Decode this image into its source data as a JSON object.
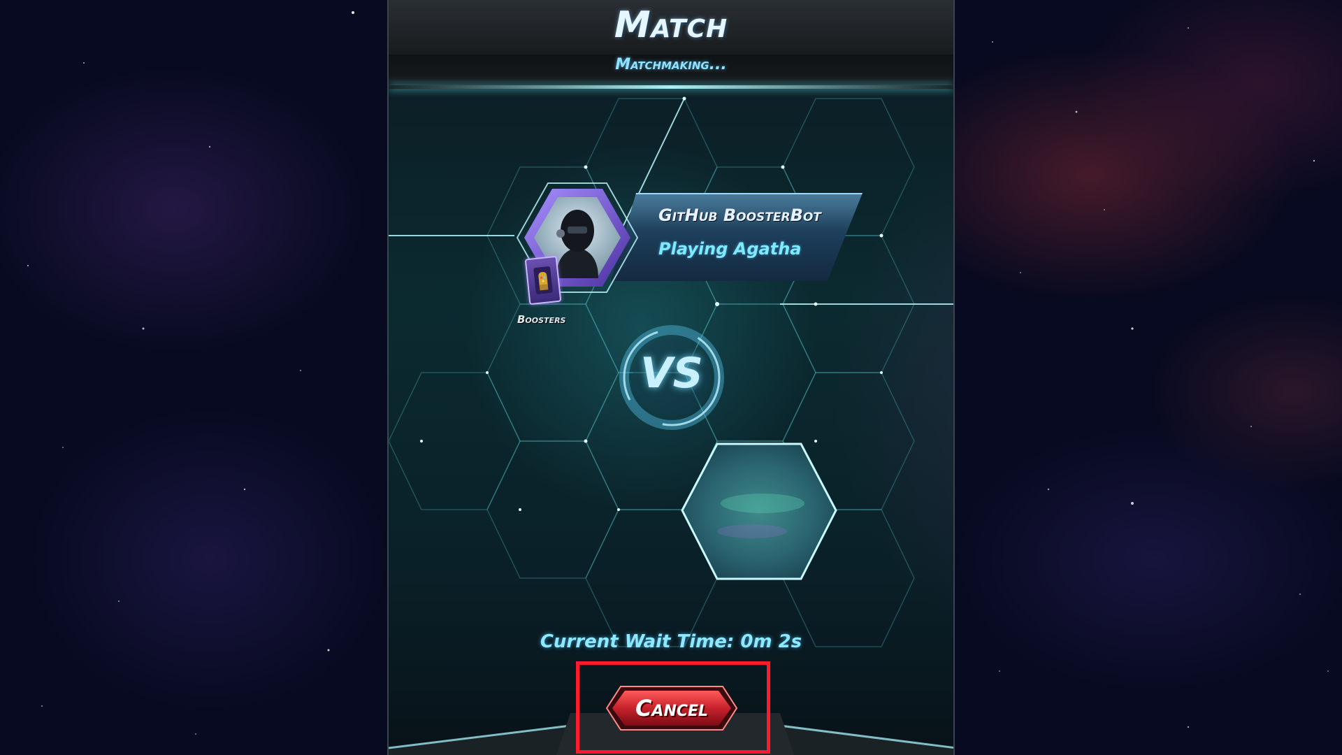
{
  "header": {
    "title": "Match",
    "subtitle": "Matchmaking..."
  },
  "player": {
    "name": "GitHub BoosterBot",
    "playing": "Playing Agatha",
    "avatar_icon": "robot-avatar-icon"
  },
  "boosters": {
    "label": "Boosters",
    "icon": "gauntlet-card-icon"
  },
  "versus": {
    "label": "VS"
  },
  "opponent": {
    "icon": "hidden-opponent-hexagon"
  },
  "status": {
    "wait_time": "Current Wait Time: 0m 2s"
  },
  "actions": {
    "cancel_label": "Cancel"
  },
  "colors": {
    "accent_cyan": "#8ee8ff",
    "cancel_red": "#c8222c",
    "highlight_red": "#ff1a2e",
    "panel_teal": "#0b2a30"
  }
}
